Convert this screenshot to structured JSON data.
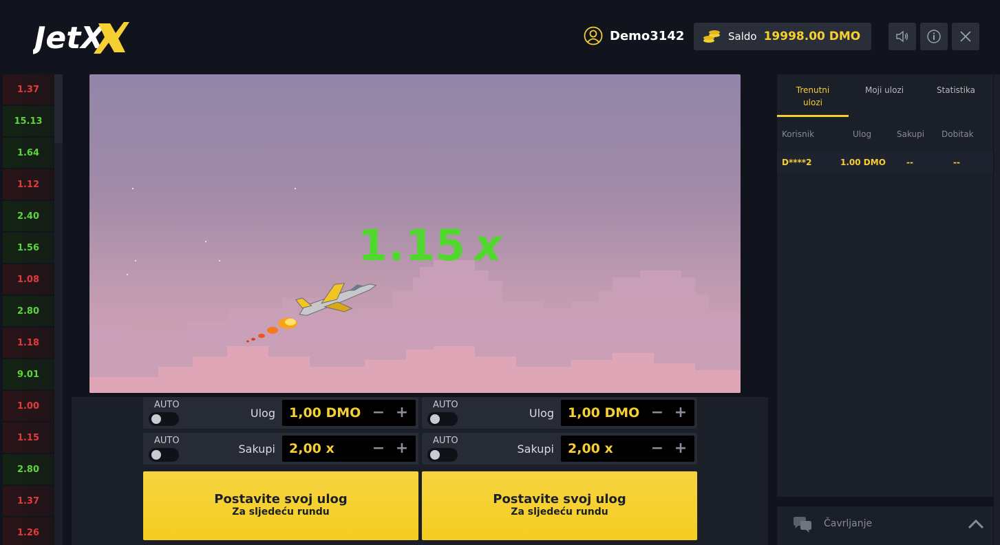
{
  "header": {
    "logo_text": "JetX",
    "username": "Demo3142",
    "balance_label": "Saldo",
    "balance_value": "19998.00 DMO",
    "icons": [
      "user-icon",
      "coins-icon",
      "sound-icon",
      "info-icon",
      "close-icon"
    ]
  },
  "history": [
    {
      "value": "1.37",
      "color": "red"
    },
    {
      "value": "15.13",
      "color": "green"
    },
    {
      "value": "1.64",
      "color": "green"
    },
    {
      "value": "1.12",
      "color": "red"
    },
    {
      "value": "2.40",
      "color": "green"
    },
    {
      "value": "1.56",
      "color": "green"
    },
    {
      "value": "1.08",
      "color": "red"
    },
    {
      "value": "2.80",
      "color": "green"
    },
    {
      "value": "1.18",
      "color": "red"
    },
    {
      "value": "9.01",
      "color": "green"
    },
    {
      "value": "1.00",
      "color": "red"
    },
    {
      "value": "1.15",
      "color": "red"
    },
    {
      "value": "2.80",
      "color": "green"
    },
    {
      "value": "1.37",
      "color": "red"
    },
    {
      "value": "1.26",
      "color": "red"
    }
  ],
  "game": {
    "multiplier": "1.15",
    "multiplier_suffix": "x"
  },
  "bets": [
    {
      "auto_label": "AUTO",
      "stake_label": "Ulog",
      "stake_value": "1,00 DMO",
      "auto_cashout_label": "AUTO",
      "cashout_label": "Sakupi",
      "cashout_value": "2,00 x",
      "button_title": "Postavite svoj ulog",
      "button_subtitle": "Za sljedeću rundu"
    },
    {
      "auto_label": "AUTO",
      "stake_label": "Ulog",
      "stake_value": "1,00 DMO",
      "auto_cashout_label": "AUTO",
      "cashout_label": "Sakupi",
      "cashout_value": "2,00 x",
      "button_title": "Postavite svoj ulog",
      "button_subtitle": "Za sljedeću rundu"
    }
  ],
  "panel": {
    "tabs": [
      {
        "label": "Trenutni ulozi",
        "active": true
      },
      {
        "label": "Moji ulozi",
        "active": false
      },
      {
        "label": "Statistika",
        "active": false
      }
    ],
    "columns": [
      "Korisnik",
      "Ulog",
      "Sakupi",
      "Dobitak"
    ],
    "rows": [
      {
        "user": "D****2",
        "stake": "1.00 DMO",
        "cashout": "--",
        "win": "--"
      }
    ]
  },
  "chat": {
    "label": "Čavrljanje"
  },
  "colors": {
    "accent": "#f6cf33",
    "win_green": "#51d82e",
    "loss_red": "#e23b3b",
    "background": "#11141c"
  }
}
